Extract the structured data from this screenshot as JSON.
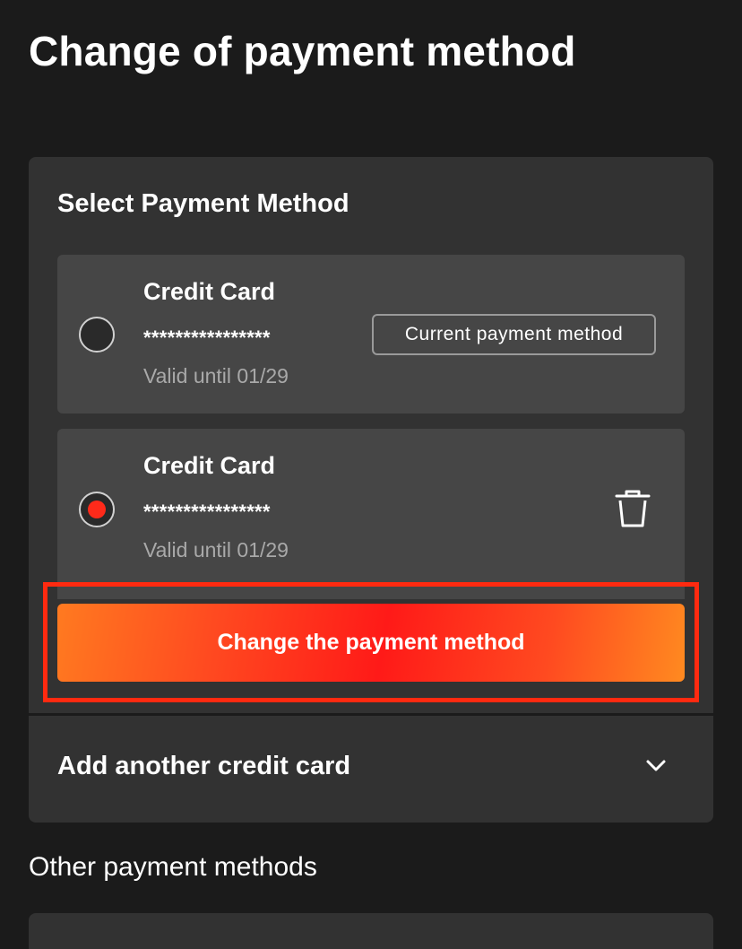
{
  "page": {
    "title": "Change of payment method"
  },
  "select_section": {
    "title": "Select Payment Method",
    "methods": [
      {
        "type": "Credit Card",
        "number": "****************",
        "valid": "Valid until 01/29",
        "badge": "Current payment method",
        "selected": false
      },
      {
        "type": "Credit Card",
        "number": "****************",
        "valid": "Valid until 01/29",
        "action_icon": "trash-icon",
        "selected": true
      }
    ],
    "change_button_label": "Change the payment method"
  },
  "add_card": {
    "label": "Add another credit card",
    "icon": "chevron-down-icon"
  },
  "other_methods": {
    "title": "Other payment methods"
  },
  "colors": {
    "background": "#1b1b1b",
    "panel": "#323232",
    "card": "#464646",
    "accent_red": "#ff2a1a",
    "accent_orange": "#ff7a20"
  }
}
